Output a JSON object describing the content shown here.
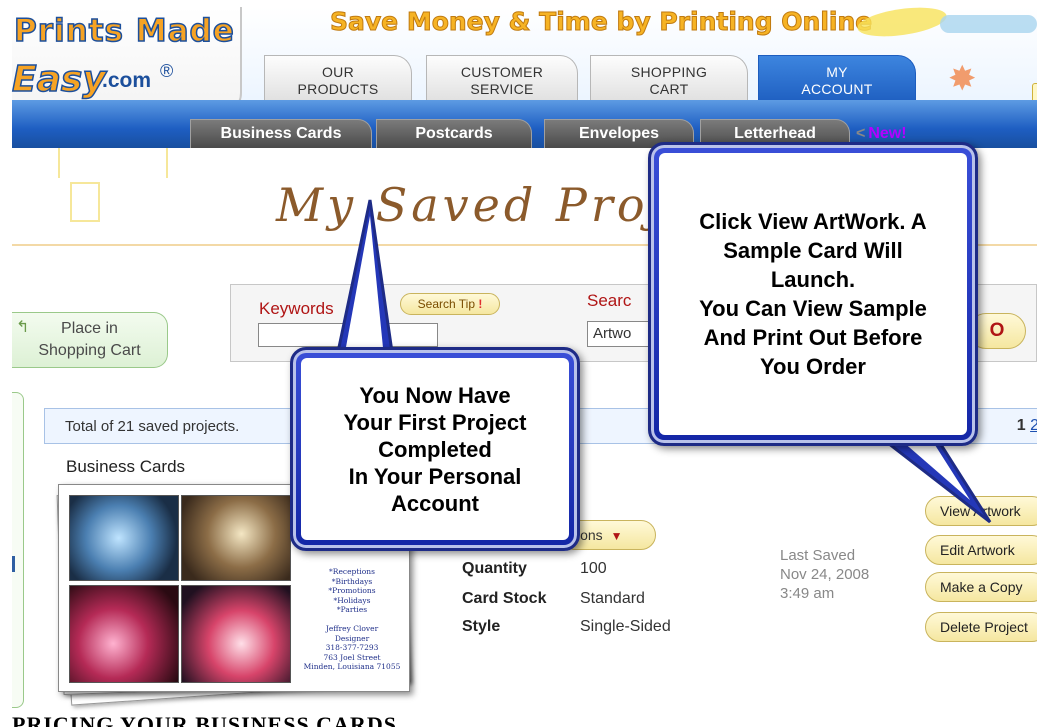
{
  "header": {
    "logo": {
      "line1": "Prints Made",
      "line2": "Easy",
      "suffix": ".com",
      "reg": "®"
    },
    "tagline": "Save Money & Time by Printing Online"
  },
  "nav_tabs": [
    {
      "label": "OUR\nPRODUCTS",
      "active": false
    },
    {
      "label": "CUSTOMER\nSERVICE",
      "active": false
    },
    {
      "label": "SHOPPING\nCART",
      "active": false
    },
    {
      "label": "MY\nACCOUNT",
      "active": true
    }
  ],
  "sub_tabs": [
    {
      "label": "Business Cards"
    },
    {
      "label": "Postcards"
    },
    {
      "label": "Envelopes"
    },
    {
      "label": "Letterhead"
    }
  ],
  "new_tab": {
    "label": "New!"
  },
  "page_title": "My Saved Proje",
  "place_in_cart": "Place in\nShopping Cart",
  "search": {
    "keywords_label": "Keywords",
    "keywords_value": "",
    "search_tip": "Search Tip",
    "search_in_label": "Searc",
    "search_in_value": "Artwo",
    "go_label": "O"
  },
  "results": {
    "total": "Total of 21 saved projects.",
    "pager_current": "1",
    "pager_next": "2"
  },
  "section_heading": "Business Cards",
  "card_preview_text": "*Receptions\n*Birthdays\n*Promotions\n*Holidays\n*Parties\n\nJeffrey Clover\nDesigner\n318-377-7293\n763 Joel Street\nMinden, Louisiana 71055",
  "options_label": "ions",
  "details": [
    {
      "key": "Quantity",
      "value": "100"
    },
    {
      "key": "Card Stock",
      "value": "Standard"
    },
    {
      "key": "Style",
      "value": "Single-Sided"
    }
  ],
  "last_saved": {
    "label": "Last Saved",
    "date": "Nov 24, 2008",
    "time": "3:49 am"
  },
  "actions": [
    {
      "label": "View Artwork"
    },
    {
      "label": "Edit Artwork"
    },
    {
      "label": "Make a Copy"
    },
    {
      "label": "Delete Project"
    }
  ],
  "callouts": {
    "first": "You Now Have\nYour First Project\nCompleted\nIn Your Personal\nAccount",
    "second": "Click View ArtWork. A\nSample Card Will\nLaunch.\nYou Can View Sample\nAnd Print Out Before\nYou Order"
  },
  "bottom_heading": "PRICING  YOUR BUSINESS  CARDS"
}
